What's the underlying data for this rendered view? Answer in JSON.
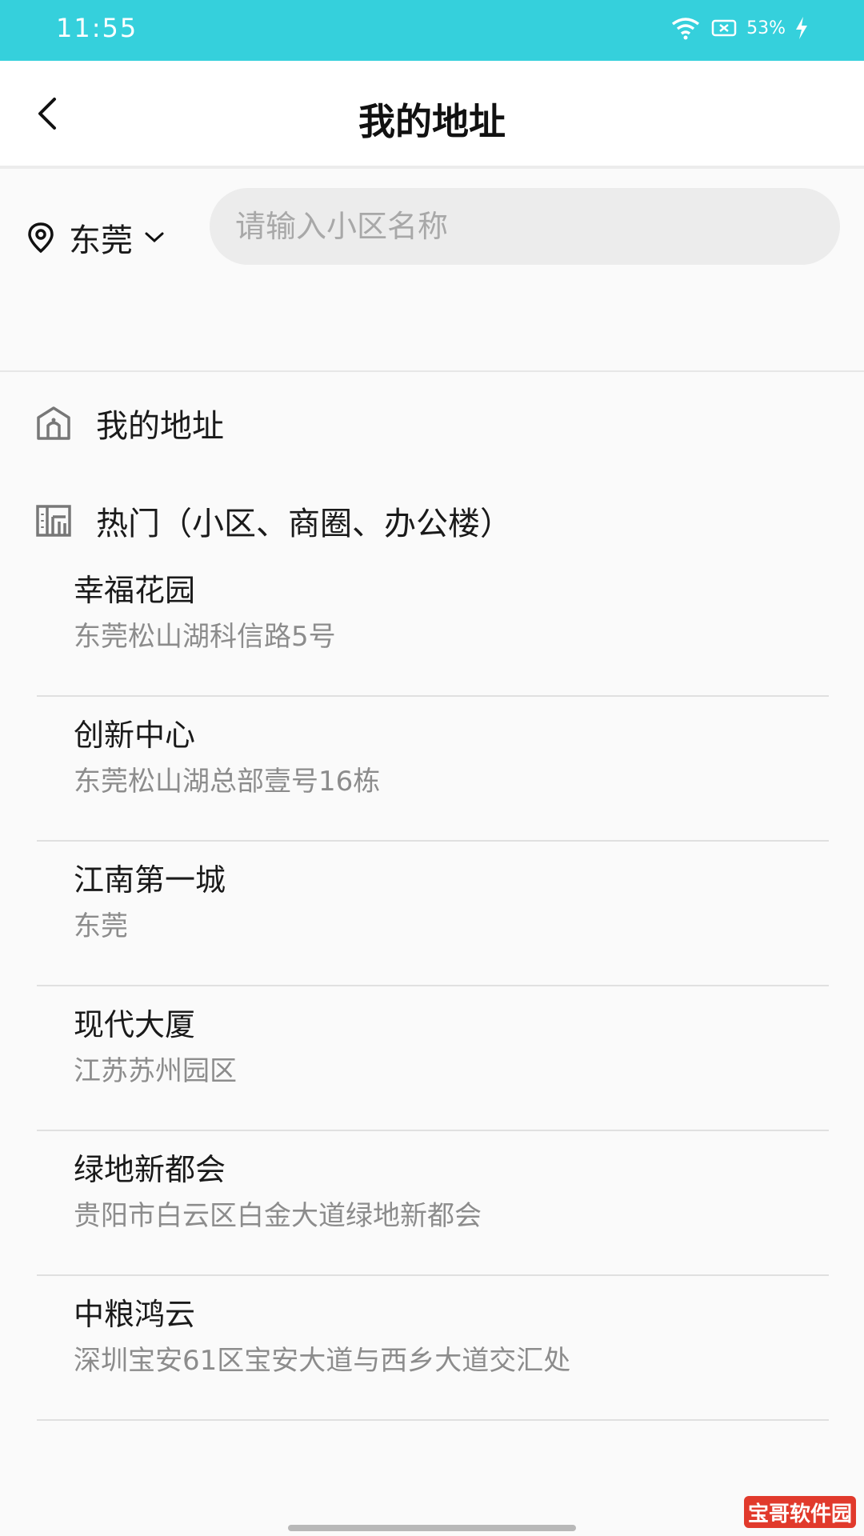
{
  "status_bar": {
    "time": "11:55",
    "battery": "53%"
  },
  "header": {
    "title": "我的地址",
    "back_icon": "chevron-left-icon"
  },
  "search": {
    "city": "东莞",
    "placeholder": "请输入小区名称"
  },
  "sections": {
    "my_address": "我的地址",
    "hot": "热门（小区、商圈、办公楼）"
  },
  "hot_items": [
    {
      "name": "幸福花园",
      "address": "东莞松山湖科信路5号"
    },
    {
      "name": "创新中心",
      "address": "东莞松山湖总部壹号16栋"
    },
    {
      "name": "江南第一城",
      "address": "东莞"
    },
    {
      "name": "现代大厦",
      "address": "江苏苏州园区"
    },
    {
      "name": "绿地新都会",
      "address": "贵阳市白云区白金大道绿地新都会"
    },
    {
      "name": "中粮鸿云",
      "address": "深圳宝安61区宝安大道与西乡大道交汇处"
    }
  ],
  "watermark": "宝哥软件园",
  "colors": {
    "status_bar": "#35d0dc",
    "secondary_text": "#8c8c8c"
  }
}
